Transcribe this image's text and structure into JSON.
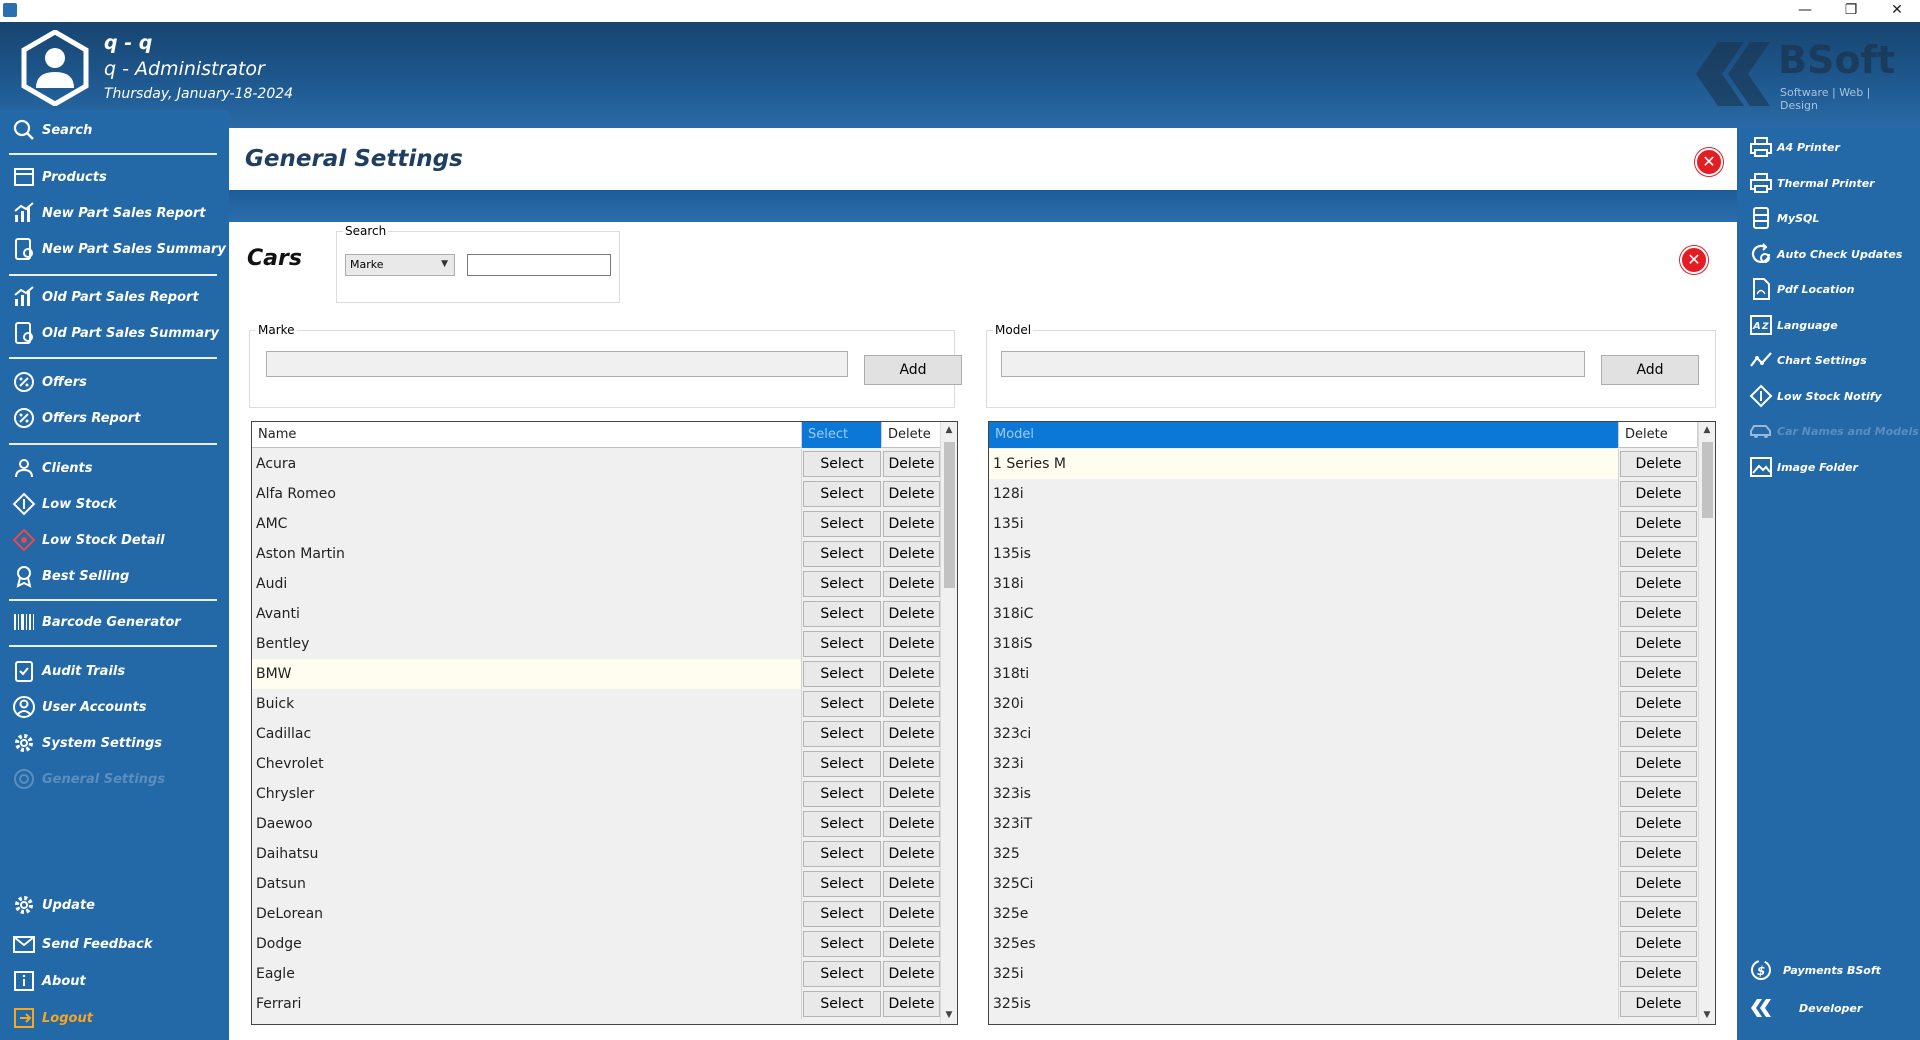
{
  "window": {
    "minimize": "—",
    "restore": "❐",
    "close": "✕"
  },
  "header": {
    "user_short": "q - q",
    "user_role": "q - Administrator",
    "date": "Thursday, January-18-2024",
    "brand_name": "BSoft",
    "brand_tagline": "Software | Web | Design"
  },
  "sidebar": {
    "items": [
      {
        "label": "Search",
        "icon": "search-icon"
      },
      {
        "label": "Products",
        "icon": "products-icon"
      },
      {
        "label": "New Part Sales Report",
        "icon": "report-icon"
      },
      {
        "label": "New Part Sales Summary",
        "icon": "summary-icon"
      },
      {
        "label": "Old Part Sales Report",
        "icon": "report-icon"
      },
      {
        "label": "Old Part Sales Summary",
        "icon": "summary-icon"
      },
      {
        "label": "Offers",
        "icon": "offer-icon"
      },
      {
        "label": "Offers Report",
        "icon": "offer-icon"
      },
      {
        "label": "Clients",
        "icon": "clients-icon"
      },
      {
        "label": "Low Stock",
        "icon": "low-stock-icon"
      },
      {
        "label": "Low Stock Detail",
        "icon": "low-stock-detail-icon"
      },
      {
        "label": "Best Selling",
        "icon": "best-selling-icon"
      },
      {
        "label": "Barcode Generator",
        "icon": "barcode-icon"
      },
      {
        "label": "Audit Trails",
        "icon": "audit-icon"
      },
      {
        "label": "User Accounts",
        "icon": "user-icon"
      },
      {
        "label": "System Settings",
        "icon": "gear-icon"
      },
      {
        "label": "General Settings",
        "icon": "general-settings-icon"
      },
      {
        "label": "Update",
        "icon": "update-icon"
      },
      {
        "label": "Send Feedback",
        "icon": "feedback-icon"
      },
      {
        "label": "About",
        "icon": "info-icon"
      },
      {
        "label": "Logout",
        "icon": "logout-icon"
      }
    ]
  },
  "rightbar": {
    "items": [
      {
        "label": "A4 Printer",
        "icon": "printer-icon"
      },
      {
        "label": "Thermal Printer",
        "icon": "printer-icon"
      },
      {
        "label": "MySQL",
        "icon": "database-icon"
      },
      {
        "label": "Auto Check Updates",
        "icon": "update-icon"
      },
      {
        "label": "Pdf Location",
        "icon": "pdf-icon"
      },
      {
        "label": "Language",
        "icon": "language-icon"
      },
      {
        "label": "Chart Settings",
        "icon": "chart-icon"
      },
      {
        "label": "Low Stock Notify",
        "icon": "low-stock-icon"
      },
      {
        "label": "Car Names and Models",
        "icon": "car-icon"
      },
      {
        "label": "Image Folder",
        "icon": "image-icon"
      },
      {
        "label": "Payments BSoft",
        "icon": "payments-icon"
      },
      {
        "label": "Developer",
        "icon": "developer-icon"
      }
    ]
  },
  "main": {
    "title": "General Settings",
    "close": "✕",
    "section_title": "Cars",
    "search_label": "Search",
    "search_filter": "Marke",
    "search_value": "",
    "marke_label": "Marke",
    "model_label": "Model",
    "add_label": "Add",
    "marke_input": "",
    "model_input": ""
  },
  "marke_grid": {
    "headers": [
      "Name",
      "Select",
      "Delete"
    ],
    "select_label": "Select",
    "delete_label": "Delete",
    "rows": [
      "Acura",
      "Alfa Romeo",
      "AMC",
      "Aston Martin",
      "Audi",
      "Avanti",
      "Bentley",
      "BMW",
      "Buick",
      "Cadillac",
      "Chevrolet",
      "Chrysler",
      "Daewoo",
      "Daihatsu",
      "Datsun",
      "DeLorean",
      "Dodge",
      "Eagle",
      "Ferrari"
    ],
    "selected": "BMW"
  },
  "model_grid": {
    "headers": [
      "Model",
      "Delete"
    ],
    "delete_label": "Delete",
    "rows": [
      "1 Series M",
      "128i",
      "135i",
      "135is",
      "318i",
      "318iC",
      "318iS",
      "318ti",
      "320i",
      "323ci",
      "323i",
      "323is",
      "323iT",
      "325",
      "325Ci",
      "325e",
      "325es",
      "325i",
      "325is"
    ],
    "selected": "1 Series M"
  },
  "colors": {
    "accent": "#2368a7",
    "header_dark": "#17446f",
    "close_red": "#e41c24",
    "selection_blue": "#0b78d8",
    "logout_orange": "#f5a623"
  }
}
